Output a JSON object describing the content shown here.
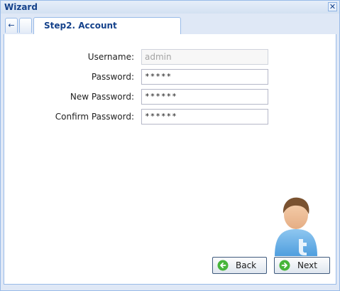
{
  "window": {
    "title": "Wizard",
    "close_glyph": "✕"
  },
  "tabs": {
    "arrow_glyph": "←",
    "active_label": "Step2. Account"
  },
  "form": {
    "username": {
      "label": "Username:",
      "value": "admin"
    },
    "password": {
      "label": "Password:",
      "value": "*****"
    },
    "new_password": {
      "label": "New Password:",
      "value": "******"
    },
    "confirm_password": {
      "label": "Confirm Password:",
      "value": "******"
    }
  },
  "buttons": {
    "back": "Back",
    "next": "Next"
  },
  "icons": {
    "close": "close-icon",
    "tab_left": "arrow-left-icon",
    "avatar": "user-avatar-icon",
    "back": "back-arrow-icon",
    "next": "next-arrow-icon"
  },
  "colors": {
    "title": "#15428b",
    "frame": "#dfe8f6",
    "border": "#99bbe8",
    "button_icon": "#47b53a"
  }
}
